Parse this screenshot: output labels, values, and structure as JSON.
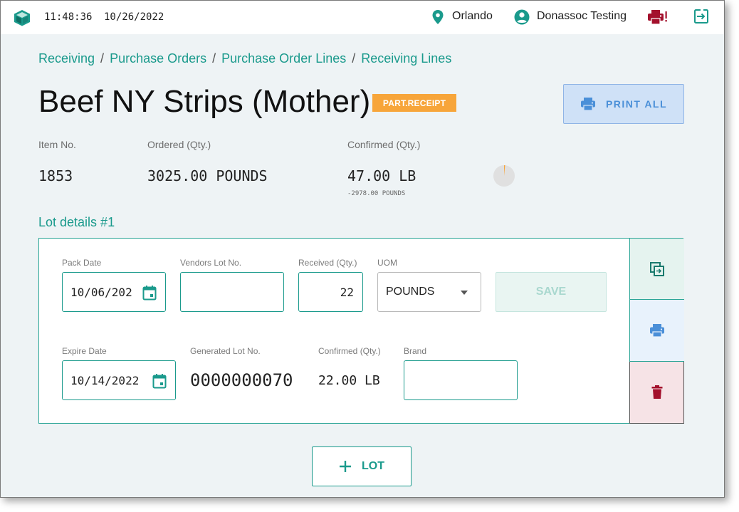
{
  "header": {
    "time": "11:48:36",
    "date": "10/26/2022",
    "location": "Orlando",
    "user": "Donassoc Testing",
    "icons": [
      "box-logo-icon",
      "map-pin-icon",
      "account-circle-icon",
      "printer-alert-icon",
      "logout-icon"
    ]
  },
  "breadcrumb": [
    "Receiving",
    "Purchase Orders",
    "Purchase Order Lines",
    "Receiving Lines"
  ],
  "title": "Beef NY Strips (Mother)",
  "status_badge": "PART.RECEIPT",
  "print_all_label": "PRINT ALL",
  "summary": {
    "item_no_label": "Item No.",
    "item_no": "1853",
    "ordered_label": "Ordered (Qty.)",
    "ordered": "3025.00 POUNDS",
    "confirmed_label": "Confirmed (Qty.)",
    "confirmed": "47.00 LB",
    "remaining": "-2978.00 POUNDS",
    "progress_fraction": 0.0155
  },
  "lot": {
    "title": "Lot details #1",
    "pack_date_label": "Pack Date",
    "pack_date": "10/06/202",
    "vendor_lot_label": "Vendors Lot No.",
    "vendor_lot": "",
    "received_label": "Received (Qty.)",
    "received": "22",
    "uom_label": "UOM",
    "uom": "POUNDS",
    "save_label": "SAVE",
    "expire_date_label": "Expire Date",
    "expire_date": "10/14/2022",
    "generated_lot_label": "Generated Lot No.",
    "generated_lot": "0000000070",
    "confirmed_label": "Confirmed (Qty.)",
    "confirmed": "22.00 LB",
    "brand_label": "Brand",
    "brand": ""
  },
  "add_lot_label": "LOT",
  "colors": {
    "accent": "#1a9a8c",
    "badge": "#f7a53a",
    "print_blue": "#4a8fd8",
    "delete_red": "#a3102c",
    "alert_red": "#b01030"
  }
}
